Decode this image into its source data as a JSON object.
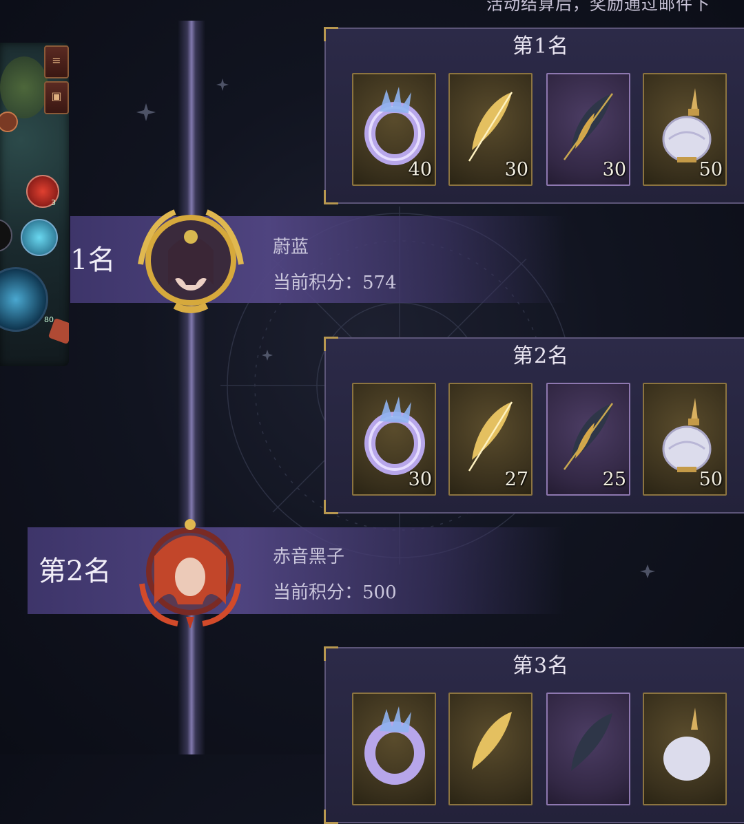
{
  "notice_text": "活动结算后，奖励通过邮件下",
  "reward_tiers": [
    {
      "title": "第1名",
      "items": [
        {
          "icon": "crystal-ring-icon",
          "qty": "40",
          "frame": "gold"
        },
        {
          "icon": "golden-feather-icon",
          "qty": "30",
          "frame": "gold"
        },
        {
          "icon": "dark-feather-icon",
          "qty": "30",
          "frame": "purple"
        },
        {
          "icon": "potion-flask-icon",
          "qty": "50",
          "frame": "gold"
        }
      ]
    },
    {
      "title": "第2名",
      "items": [
        {
          "icon": "crystal-ring-icon",
          "qty": "30",
          "frame": "gold"
        },
        {
          "icon": "golden-feather-icon",
          "qty": "27",
          "frame": "gold"
        },
        {
          "icon": "dark-feather-icon",
          "qty": "25",
          "frame": "purple"
        },
        {
          "icon": "potion-flask-icon",
          "qty": "50",
          "frame": "gold"
        }
      ]
    },
    {
      "title": "第3名",
      "items": [
        {
          "icon": "crystal-ring-icon",
          "qty": "",
          "frame": "gold"
        },
        {
          "icon": "golden-feather-icon",
          "qty": "",
          "frame": "gold"
        },
        {
          "icon": "dark-feather-icon",
          "qty": "",
          "frame": "purple"
        },
        {
          "icon": "potion-flask-icon",
          "qty": "",
          "frame": "gold"
        }
      ]
    }
  ],
  "rankings": [
    {
      "rank": "1名",
      "name": "蔚蓝",
      "score": "当前积分：574",
      "frame": "golden-laurel"
    },
    {
      "rank": "第2名",
      "name": "赤音黑子",
      "score": "当前积分：500",
      "frame": "flame"
    }
  ],
  "side_panel": {
    "badge_count": "3",
    "level_text": "80"
  },
  "colors": {
    "gold": "#b89850",
    "purple_frame": "#8e78b0",
    "banner": "#524684"
  }
}
